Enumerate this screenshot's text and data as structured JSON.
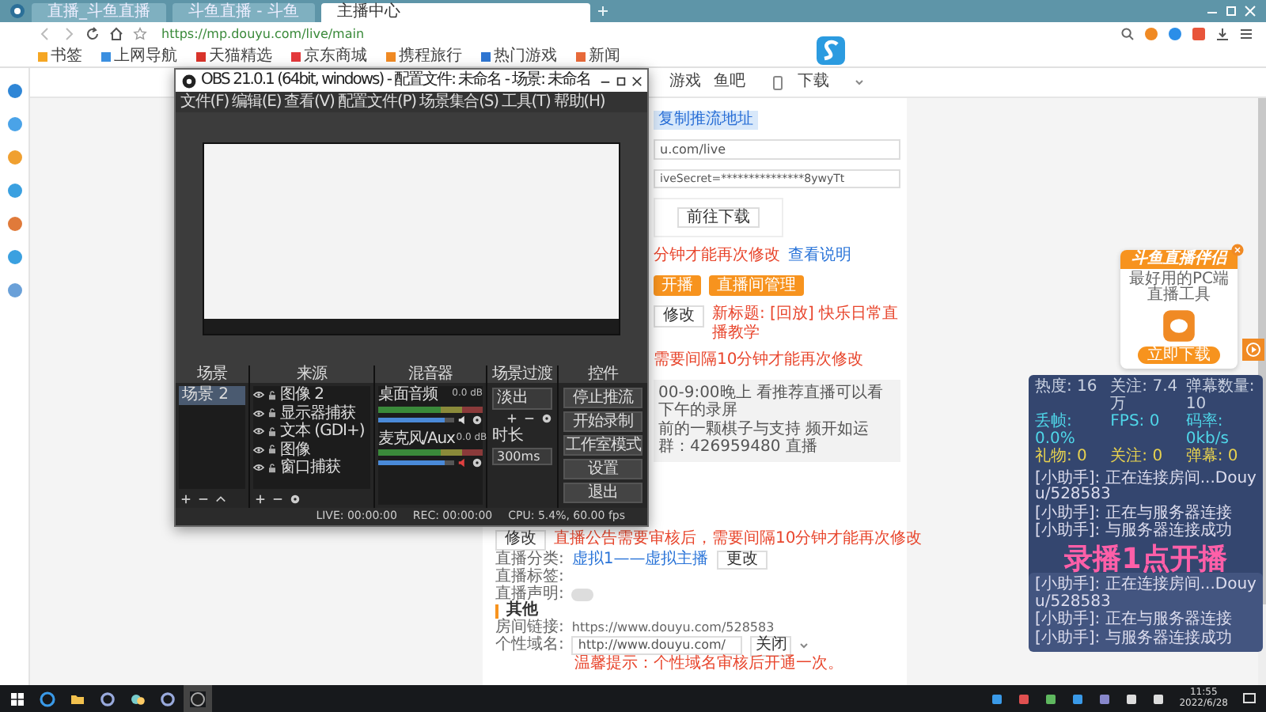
{
  "browser": {
    "tabs": [
      {
        "title": "直播_斗鱼直播",
        "selected": false
      },
      {
        "title": "斗鱼直播 - 斗鱼",
        "selected": false
      },
      {
        "title": "主播中心",
        "selected": true
      }
    ],
    "url": "https://mp.douyu.com/live/main",
    "bookmarks": [
      {
        "label": "书签",
        "color": "#f5a623"
      },
      {
        "label": "上网导航",
        "color": "#3b8fe0"
      },
      {
        "label": "天猫精选",
        "color": "#d9342b"
      },
      {
        "label": "京东商城",
        "color": "#e4393c"
      },
      {
        "label": "携程旅行",
        "color": "#f08a24"
      },
      {
        "label": "热门游戏",
        "color": "#2f76d2"
      },
      {
        "label": "新闻",
        "color": "#e86a3a"
      }
    ]
  },
  "site_nav": {
    "links": [
      "游戏",
      "鱼吧"
    ],
    "download": "下载"
  },
  "stream_settings": {
    "copy_link": "复制推流地址",
    "server_value": "u.com/live",
    "key_value": "iveSecret=***************8ywyTt",
    "download_button": "前往下载",
    "key_note": "分钟才能再次修改",
    "key_help": "查看说明",
    "actions": [
      "开播",
      "直播间管理"
    ],
    "title_edit": "修改",
    "title_new": "新标题: [回放] 快乐日常直播教学",
    "title_note": "需要间隔10分钟才能再次修改",
    "notice_lines": [
      "00-9:00晚上 看推荐直播可以看下午的录屏",
      "前的一颗棋子与支持 频开如运群：426959480 直播"
    ],
    "notice_edit": "修改",
    "notice_note": "直播公告需要审核后，需要间隔10分钟才能再次修改",
    "category": {
      "label": "直播分类:",
      "value": "虚拟1——虚拟主播",
      "button": "更改"
    },
    "tags": {
      "label": "直播标签:"
    },
    "declaration": {
      "label": "直播声明:",
      "on": false
    }
  },
  "other": {
    "heading": "其他",
    "room_link": {
      "label": "房间链接:",
      "value": "https://www.douyu.com/528583"
    },
    "domain": {
      "label": "个性域名:",
      "value": "http://www.douyu.com/",
      "select": "关闭",
      "note": "温馨提示：个性域名审核后开通一次。"
    }
  },
  "obs": {
    "title": "OBS 21.0.1 (64bit, windows) - 配置文件: 未命名 - 场景: 未命名",
    "menu": [
      "文件(F)",
      "编辑(E)",
      "查看(V)",
      "配置文件(P)",
      "场景集合(S)",
      "工具(T)",
      "帮助(H)"
    ],
    "scenes": {
      "title": "场景",
      "items": [
        {
          "label": "场景 2",
          "selected": true
        }
      ]
    },
    "sources": {
      "title": "来源",
      "items": [
        "图像 2",
        "显示器捕获",
        "文本 (GDI+)",
        "图像",
        "窗口捕获"
      ]
    },
    "mixer": {
      "title": "混音器",
      "channels": [
        {
          "name": "桌面音频",
          "reading": "0.0 dB",
          "level": 0.88,
          "muted": false
        },
        {
          "name": "麦克风/Aux",
          "reading": "0.0 dB",
          "level": 0.88,
          "muted": true
        }
      ]
    },
    "transitions": {
      "title": "场景过渡",
      "value": "淡出",
      "duration_label": "时长",
      "duration": "300ms"
    },
    "controls": {
      "title": "控件",
      "buttons": [
        "停止推流",
        "开始录制",
        "工作室模式",
        "设置",
        "退出"
      ]
    },
    "status": [
      "LIVE: 00:00:00",
      "REC: 00:00:00",
      "CPU: 5.4%, 60.00 fps"
    ]
  },
  "ad": {
    "title": "斗鱼直播伴侣",
    "subtitle": "最好用的PC端直播工具",
    "button": "立即下载"
  },
  "stats_panel": {
    "stats": [
      {
        "text": "热度: 16",
        "color": "#c8d0e0"
      },
      {
        "text": "关注: 7.4万",
        "color": "#c8d0e0"
      },
      {
        "text": "弹幕数量: 10",
        "color": "#c8d0e0"
      },
      {
        "text": "丢帧: 0.0%",
        "color": "#4fd6e8"
      },
      {
        "text": "FPS: 0",
        "color": "#4fd6e8"
      },
      {
        "text": "码率: 0kb/s",
        "color": "#4fd6e8"
      },
      {
        "text": "礼物: 0",
        "color": "#e8d24f"
      },
      {
        "text": "关注: 0",
        "color": "#e8d24f"
      },
      {
        "text": "弹幕: 0",
        "color": "#e8d24f"
      }
    ],
    "messages": [
      "[小助手]: 正在连接房间...Douyu/528583",
      "[小助手]: 正在与服务器连接",
      "[小助手]: 与服务器连接成功"
    ],
    "overlay_text": "录播1点开播"
  },
  "chat_panel": {
    "messages": [
      "[小助手]: 正在连接房间...Douyu/528583",
      "[小助手]: 正在与服务器连接",
      "[小助手]: 与服务器连接成功"
    ]
  },
  "taskbar": {
    "time": "11:55",
    "date": "2022/6/28"
  }
}
